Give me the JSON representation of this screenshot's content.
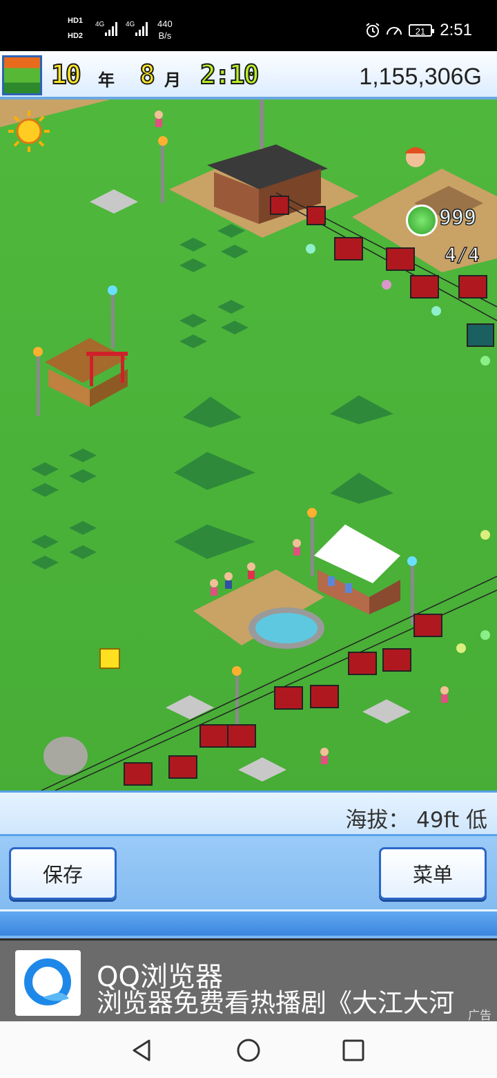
{
  "status_bar": {
    "hd1": "HD1",
    "hd2": "HD2",
    "sig1": "4G",
    "sig2": "4G",
    "speed_value": "440",
    "speed_unit": "B/s",
    "battery": "21",
    "time": "2:51"
  },
  "hud": {
    "year": "10",
    "year_unit": "年",
    "month": "8",
    "month_unit": "月",
    "clock": "2:10",
    "money": "1,155,306G"
  },
  "game": {
    "points": "999",
    "staff_count": "4/4"
  },
  "panel": {
    "altitude": "海拔：  49ft 低",
    "save_label": "保存",
    "menu_label": "菜单"
  },
  "ad": {
    "title": "QQ浏览器",
    "description": "浏览器免费看热播剧《大江大河",
    "tag": "广告"
  },
  "colors": {
    "grass": "#4db83a",
    "dirt": "#c9a266",
    "panel_blue": "#2a66c9",
    "year_yellow": "#ffe72a",
    "clock_green": "#b8f02a"
  },
  "icons": [
    "sun-icon",
    "alarm-icon",
    "speed-icon",
    "battery-icon",
    "back-icon",
    "home-icon",
    "recent-icon",
    "qq-browser-icon"
  ]
}
